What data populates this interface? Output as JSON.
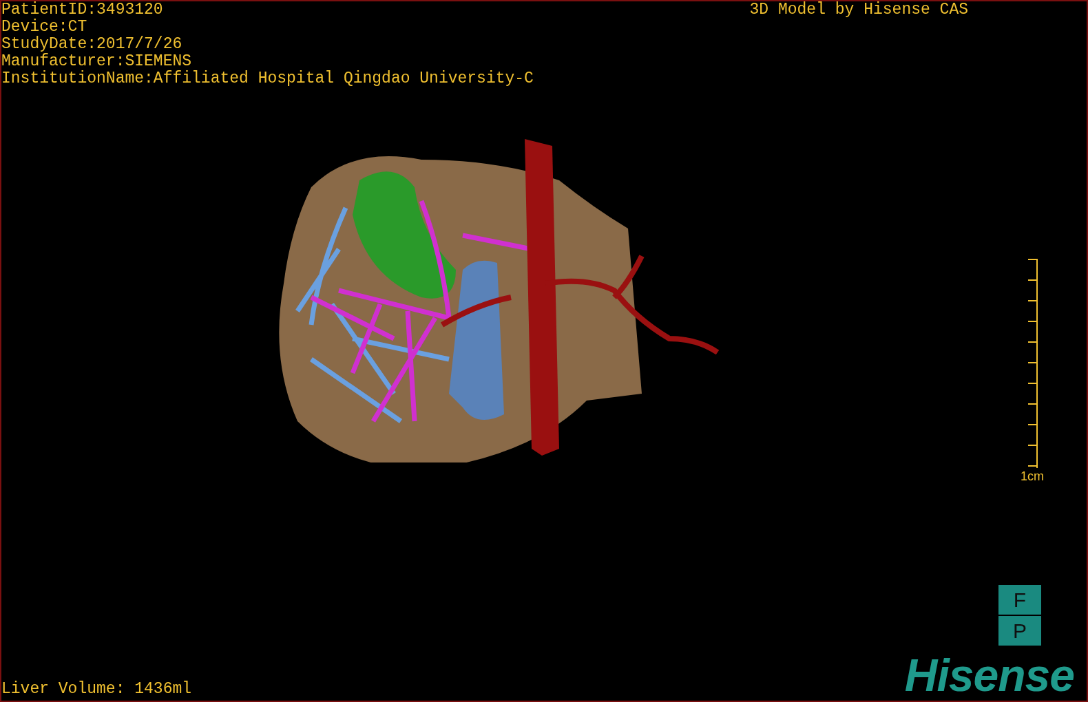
{
  "info_lines": [
    "PatientID:3493120",
    "Device:CT",
    "StudyDate:2017/7/26",
    "Manufacturer:SIEMENS",
    "InstitutionName:Affiliated Hospital Qingdao University-C"
  ],
  "title": "3D Model by Hisense CAS",
  "scale_bar": {
    "label": "1cm"
  },
  "orientation_marker": {
    "top": "F",
    "bottom": "P"
  },
  "volume": "Liver Volume: 1436ml",
  "logo": "Hisense"
}
